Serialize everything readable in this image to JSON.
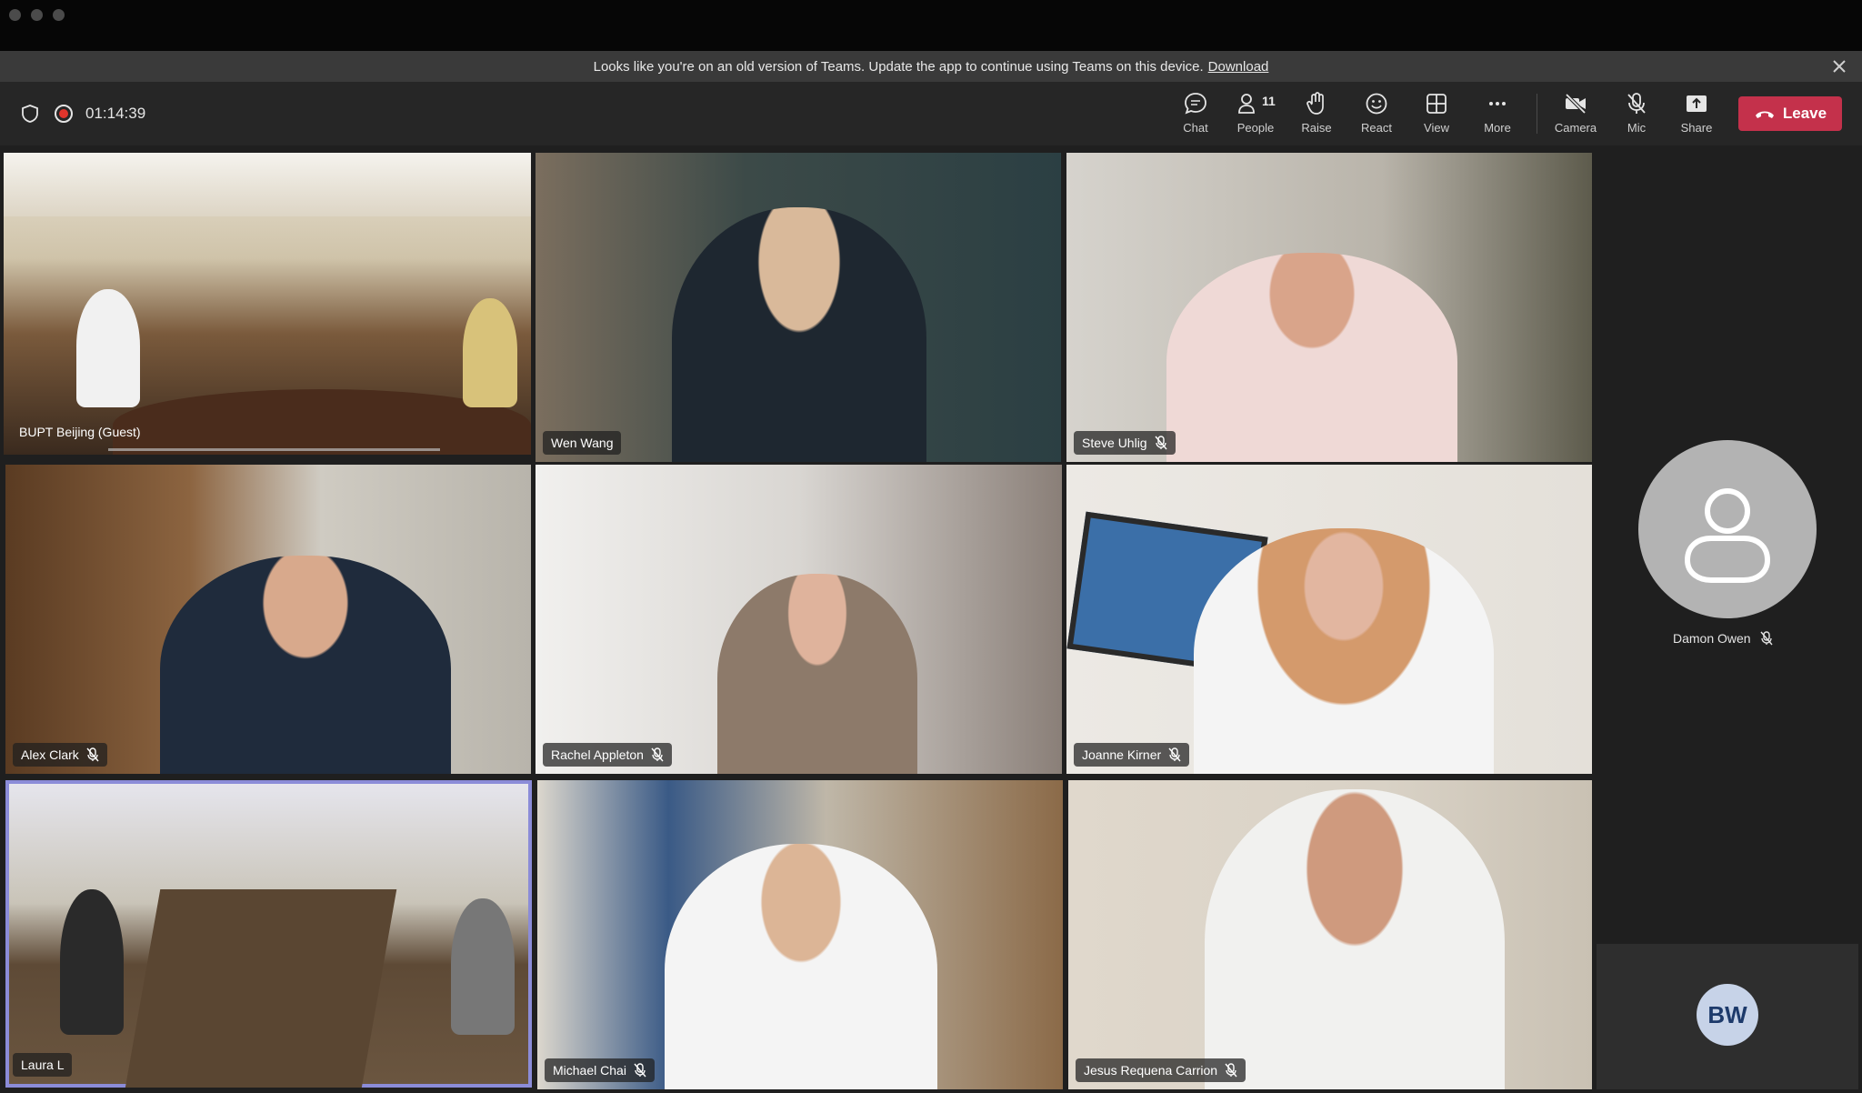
{
  "window": {
    "banner_text": "Looks like you're on an old version of Teams. Update the app to continue using Teams on this device.",
    "banner_link": "Download"
  },
  "meeting": {
    "timer": "01:14:39",
    "toolbar": {
      "chat": "Chat",
      "people": "People",
      "people_count": "11",
      "raise": "Raise",
      "react": "React",
      "view": "View",
      "more": "More",
      "camera": "Camera",
      "mic": "Mic",
      "share": "Share",
      "leave": "Leave"
    },
    "accent_leave": "#c4314b",
    "participants": [
      {
        "name": "BUPT Beijing (Guest)",
        "muted": false
      },
      {
        "name": "Wen Wang",
        "muted": false
      },
      {
        "name": "Steve Uhlig",
        "muted": true
      },
      {
        "name": "Alex Clark",
        "muted": true
      },
      {
        "name": "Rachel Appleton",
        "muted": true
      },
      {
        "name": "Joanne Kirner",
        "muted": true
      },
      {
        "name": "Laura L",
        "muted": false,
        "active_speaker": true
      },
      {
        "name": "Michael Chai",
        "muted": true
      },
      {
        "name": "Jesus Requena Carrion",
        "muted": true
      }
    ],
    "roster_side": {
      "name": "Damon Owen",
      "muted": true
    },
    "self_initials": "BW"
  }
}
